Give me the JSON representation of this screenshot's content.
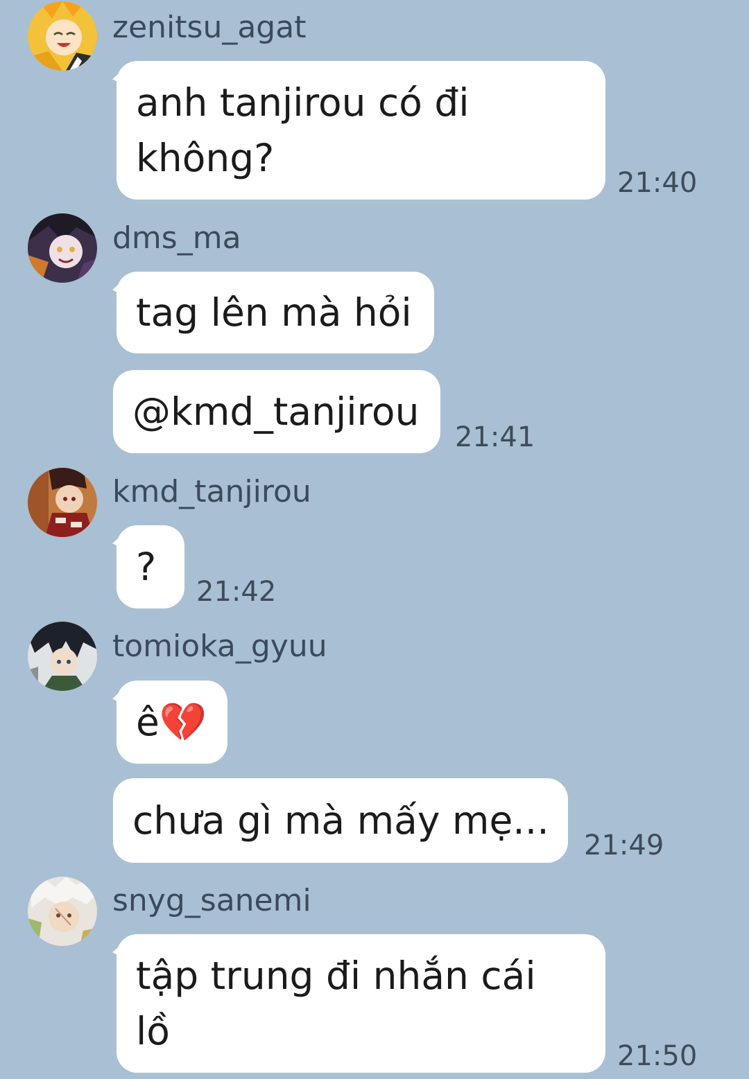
{
  "chat": {
    "messages": [
      {
        "username": "zenitsu_agat",
        "avatar_icon": "zenitsu-avatar",
        "bubbles": [
          {
            "lines": [
              "anh tanjirou có đi",
              "không?"
            ],
            "time": "21:40"
          }
        ]
      },
      {
        "username": "dms_ma",
        "avatar_icon": "douma-avatar",
        "bubbles": [
          {
            "lines": [
              "tag lên mà hỏi"
            ],
            "time": ""
          },
          {
            "lines": [
              "@kmd_tanjirou"
            ],
            "time": "21:41"
          }
        ]
      },
      {
        "username": "kmd_tanjirou",
        "avatar_icon": "tanjirou-avatar",
        "bubbles": [
          {
            "lines": [
              "?"
            ],
            "time": "21:42"
          }
        ]
      },
      {
        "username": "tomioka_gyuu",
        "avatar_icon": "giyuu-avatar",
        "bubbles": [
          {
            "lines": [
              "ê💔"
            ],
            "time": ""
          },
          {
            "lines": [
              "chưa gì mà mấy mẹ..."
            ],
            "time": "21:49"
          }
        ]
      },
      {
        "username": "snyg_sanemi",
        "avatar_icon": "sanemi-avatar",
        "bubbles": [
          {
            "lines": [
              "tập trung đi nhắn cái",
              "lồ"
            ],
            "time": "21:50"
          }
        ]
      }
    ]
  }
}
